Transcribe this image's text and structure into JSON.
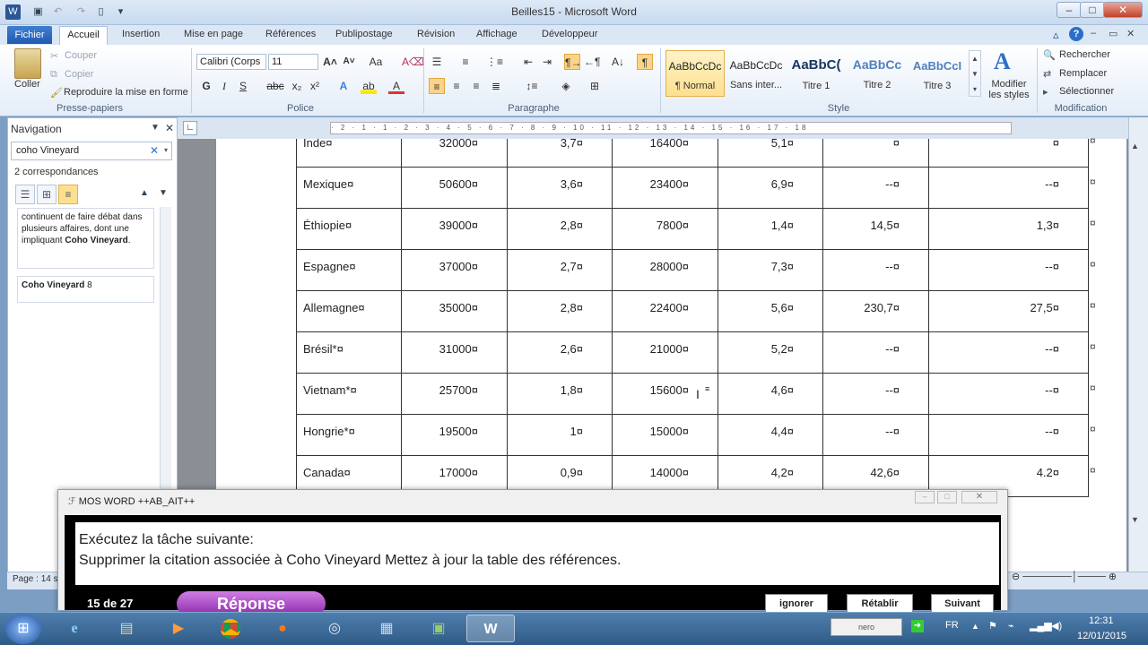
{
  "window": {
    "title": "Beilles15 - Microsoft Word",
    "minimize": "–",
    "maximize": "□",
    "close": "✕"
  },
  "tabs": {
    "file": "Fichier",
    "home": "Accueil",
    "items": [
      "Insertion",
      "Mise en page",
      "Références",
      "Publipostage",
      "Révision",
      "Affichage",
      "Développeur"
    ]
  },
  "ribbon": {
    "clipboard": {
      "paste": "Coller",
      "cut": "Couper",
      "copy": "Copier",
      "format_painter": "Reproduire la mise en forme",
      "label": "Presse-papiers"
    },
    "font": {
      "name": "Calibri (Corps",
      "size": "11",
      "label": "Police"
    },
    "paragraph": {
      "label": "Paragraphe"
    },
    "styles": {
      "label": "Style",
      "items": [
        {
          "sample": "AaBbCcDc",
          "name": "¶ Normal"
        },
        {
          "sample": "AaBbCcDc",
          "name": "Sans inter..."
        },
        {
          "sample": "AaBbC(",
          "name": "Titre 1"
        },
        {
          "sample": "AaBbCc",
          "name": "Titre 2"
        },
        {
          "sample": "AaBbCcI",
          "name": "Titre 3"
        }
      ],
      "change": "Modifier les styles"
    },
    "editing": {
      "find": "Rechercher",
      "replace": "Remplacer",
      "select": "Sélectionner",
      "label": "Modification"
    }
  },
  "navigation": {
    "title": "Navigation",
    "search_value": "coho Vineyard",
    "match_count": "2 correspondances",
    "result1_prefix": "continuent de faire débat dans plusieurs affaires, dont une impliquant ",
    "result1_bold": "Coho Vineyard",
    "result1_suffix": ".",
    "result2_bold": "Coho Vineyard",
    "result2_suffix": " 8"
  },
  "table": {
    "rows": [
      [
        "Inde¤",
        "32000¤",
        "3,7¤",
        "16400¤",
        "5,1¤",
        "¤",
        "¤"
      ],
      [
        "Mexique¤",
        "50600¤",
        "3,6¤",
        "23400¤",
        "6,9¤",
        "--¤",
        "--¤"
      ],
      [
        "Éthiopie¤",
        "39000¤",
        "2,8¤",
        "7800¤",
        "1,4¤",
        "14,5¤",
        "1,3¤"
      ],
      [
        "Espagne¤",
        "37000¤",
        "2,7¤",
        "28000¤",
        "7,3¤",
        "--¤",
        "--¤"
      ],
      [
        "Allemagne¤",
        "35000¤",
        "2,8¤",
        "22400¤",
        "5,6¤",
        "230,7¤",
        "27,5¤"
      ],
      [
        "Brésil*¤",
        "31000¤",
        "2,6¤",
        "21000¤",
        "5,2¤",
        "--¤",
        "--¤"
      ],
      [
        "Vietnam*¤",
        "25700¤",
        "1,8¤",
        "15600¤",
        "4,6¤",
        "--¤",
        "--¤"
      ],
      [
        "Hongrie*¤",
        "19500¤",
        "1¤",
        "15000¤",
        "4,4¤",
        "--¤",
        "--¤"
      ],
      [
        "Canada¤",
        "17000¤",
        "0,9¤",
        "14000¤",
        "4,2¤",
        "42,6¤",
        "4.2¤"
      ]
    ],
    "row_end_mark": "¤"
  },
  "status": {
    "page": "Page : 14 s"
  },
  "mos": {
    "title": "MOS WORD ++AB_AIT++",
    "line1": "Exécutez la tâche suivante:",
    "line2": "Supprimer la citation associée à Coho Vineyard Mettez à jour la table des références.",
    "counter": "15 de 27",
    "answer": "Réponse",
    "ignore": "ignorer",
    "reset": "Rétablir",
    "next": "Suivant"
  },
  "taskbar": {
    "lang": "FR",
    "time": "12:31",
    "date": "12/01/2015",
    "nero": "nero"
  }
}
